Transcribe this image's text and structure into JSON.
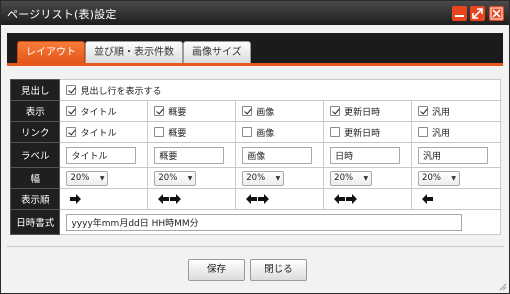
{
  "window": {
    "title": "ページリスト(表)設定"
  },
  "tabs": [
    "レイアウト",
    "並び順・表示件数",
    "画像サイズ"
  ],
  "rows": {
    "heading": {
      "label": "見出し",
      "checkbox_label": "見出し行を表示する",
      "checked": true
    },
    "display": {
      "label": "表示",
      "items": [
        {
          "label": "タイトル",
          "checked": true
        },
        {
          "label": "概要",
          "checked": true
        },
        {
          "label": "画像",
          "checked": true
        },
        {
          "label": "更新日時",
          "checked": true
        },
        {
          "label": "汎用",
          "checked": true
        }
      ]
    },
    "link": {
      "label": "リンク",
      "items": [
        {
          "label": "タイトル",
          "checked": true
        },
        {
          "label": "概要",
          "checked": false
        },
        {
          "label": "画像",
          "checked": false
        },
        {
          "label": "更新日時",
          "checked": false
        },
        {
          "label": "汎用",
          "checked": false
        }
      ]
    },
    "label_row": {
      "label": "ラベル",
      "values": [
        "タイトル",
        "概要",
        "画像",
        "日時",
        "汎用"
      ]
    },
    "width": {
      "label": "幅",
      "values": [
        "20%",
        "20%",
        "20%",
        "20%",
        "20%"
      ]
    },
    "order": {
      "label": "表示順",
      "arrows": [
        [
          "right"
        ],
        [
          "left",
          "right"
        ],
        [
          "left",
          "right"
        ],
        [
          "left",
          "right"
        ],
        [
          "left"
        ]
      ]
    },
    "date_format": {
      "label": "日時書式",
      "value": "yyyy年mm月dd日 HH時MM分"
    }
  },
  "buttons": {
    "save": "保存",
    "close": "閉じる"
  },
  "colors": {
    "accent": "#e85a1c",
    "titlebar": "#2b2b2b",
    "window_button": "#e8451e"
  }
}
